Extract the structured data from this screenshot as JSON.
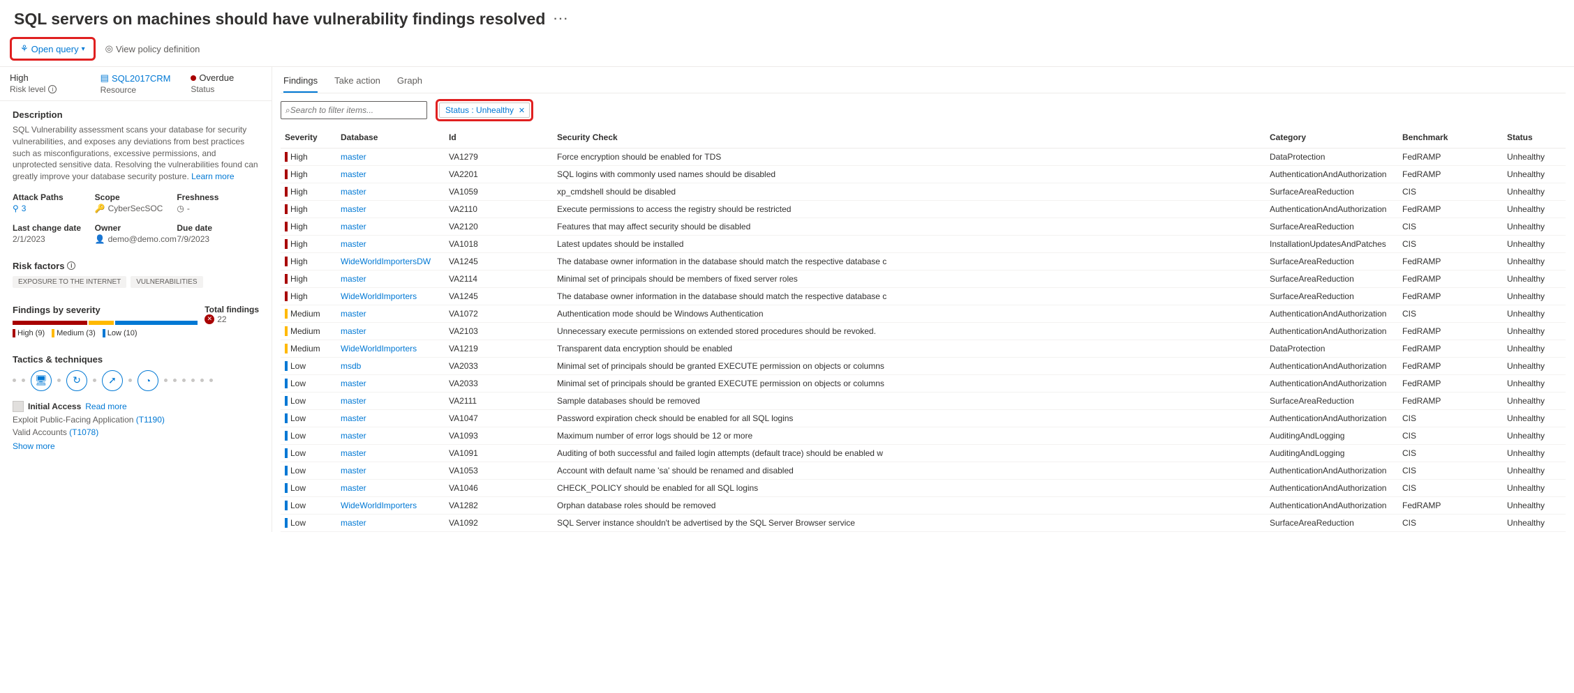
{
  "title": "SQL servers on machines should have vulnerability findings resolved",
  "toolbar": {
    "open_query": "Open query",
    "view_policy": "View policy definition"
  },
  "summary": {
    "risk_value": "High",
    "risk_label": "Risk level",
    "resource_value": "SQL2017CRM",
    "resource_label": "Resource",
    "status_value": "Overdue",
    "status_label": "Status"
  },
  "description": {
    "heading": "Description",
    "text": "SQL Vulnerability assessment scans your database for security vulnerabilities, and exposes any deviations from best practices such as misconfigurations, excessive permissions, and unprotected sensitive data. Resolving the vulnerabilities found can greatly improve your database security posture. ",
    "learn_more": "Learn more"
  },
  "meta1": {
    "attack_paths_lbl": "Attack Paths",
    "attack_paths_val": "3",
    "scope_lbl": "Scope",
    "scope_val": "CyberSecSOC",
    "freshness_lbl": "Freshness",
    "freshness_val": "-"
  },
  "meta2": {
    "last_change_lbl": "Last change date",
    "last_change_val": "2/1/2023",
    "owner_lbl": "Owner",
    "owner_val": "demo@demo.com",
    "due_lbl": "Due date",
    "due_val": "7/9/2023"
  },
  "risk_factors": {
    "heading": "Risk factors",
    "tags": [
      "EXPOSURE TO THE INTERNET",
      "VULNERABILITIES"
    ]
  },
  "findings_sev": {
    "heading": "Findings by severity",
    "high": "High (9)",
    "medium": "Medium (3)",
    "low": "Low (10)",
    "total_lbl": "Total findings",
    "total_val": "22"
  },
  "tactics": {
    "heading": "Tactics & techniques",
    "initial_access": "Initial Access",
    "read_more": "Read more",
    "line1a": "Exploit Public-Facing Application ",
    "line1b": "(T1190)",
    "line2a": "Valid Accounts ",
    "line2b": "(T1078)",
    "show_more": "Show more"
  },
  "tabs": {
    "findings": "Findings",
    "take_action": "Take action",
    "graph": "Graph"
  },
  "search": {
    "placeholder": "Search to filter items..."
  },
  "filter": {
    "label": "Status : Unhealthy"
  },
  "columns": {
    "severity": "Severity",
    "database": "Database",
    "id": "Id",
    "security_check": "Security Check",
    "category": "Category",
    "benchmark": "Benchmark",
    "status": "Status"
  },
  "rows": [
    {
      "sev": "High",
      "db": "master",
      "id": "VA1279",
      "check": "Force encryption should be enabled for TDS",
      "cat": "DataProtection",
      "bench": "FedRAMP",
      "status": "Unhealthy"
    },
    {
      "sev": "High",
      "db": "master",
      "id": "VA2201",
      "check": "SQL logins with commonly used names should be disabled",
      "cat": "AuthenticationAndAuthorization",
      "bench": "FedRAMP",
      "status": "Unhealthy"
    },
    {
      "sev": "High",
      "db": "master",
      "id": "VA1059",
      "check": "xp_cmdshell should be disabled",
      "cat": "SurfaceAreaReduction",
      "bench": "CIS",
      "status": "Unhealthy"
    },
    {
      "sev": "High",
      "db": "master",
      "id": "VA2110",
      "check": "Execute permissions to access the registry should be restricted",
      "cat": "AuthenticationAndAuthorization",
      "bench": "FedRAMP",
      "status": "Unhealthy"
    },
    {
      "sev": "High",
      "db": "master",
      "id": "VA2120",
      "check": "Features that may affect security should be disabled",
      "cat": "SurfaceAreaReduction",
      "bench": "CIS",
      "status": "Unhealthy"
    },
    {
      "sev": "High",
      "db": "master",
      "id": "VA1018",
      "check": "Latest updates should be installed",
      "cat": "InstallationUpdatesAndPatches",
      "bench": "CIS",
      "status": "Unhealthy"
    },
    {
      "sev": "High",
      "db": "WideWorldImportersDW",
      "id": "VA1245",
      "check": "The database owner information in the database should match the respective database c",
      "cat": "SurfaceAreaReduction",
      "bench": "FedRAMP",
      "status": "Unhealthy"
    },
    {
      "sev": "High",
      "db": "master",
      "id": "VA2114",
      "check": "Minimal set of principals should be members of fixed server roles",
      "cat": "SurfaceAreaReduction",
      "bench": "FedRAMP",
      "status": "Unhealthy"
    },
    {
      "sev": "High",
      "db": "WideWorldImporters",
      "id": "VA1245",
      "check": "The database owner information in the database should match the respective database c",
      "cat": "SurfaceAreaReduction",
      "bench": "FedRAMP",
      "status": "Unhealthy"
    },
    {
      "sev": "Medium",
      "db": "master",
      "id": "VA1072",
      "check": "Authentication mode should be Windows Authentication",
      "cat": "AuthenticationAndAuthorization",
      "bench": "CIS",
      "status": "Unhealthy"
    },
    {
      "sev": "Medium",
      "db": "master",
      "id": "VA2103",
      "check": "Unnecessary execute permissions on extended stored procedures should be revoked.",
      "cat": "AuthenticationAndAuthorization",
      "bench": "FedRAMP",
      "status": "Unhealthy"
    },
    {
      "sev": "Medium",
      "db": "WideWorldImporters",
      "id": "VA1219",
      "check": "Transparent data encryption should be enabled",
      "cat": "DataProtection",
      "bench": "FedRAMP",
      "status": "Unhealthy"
    },
    {
      "sev": "Low",
      "db": "msdb",
      "id": "VA2033",
      "check": "Minimal set of principals should be granted EXECUTE permission on objects or columns",
      "cat": "AuthenticationAndAuthorization",
      "bench": "FedRAMP",
      "status": "Unhealthy"
    },
    {
      "sev": "Low",
      "db": "master",
      "id": "VA2033",
      "check": "Minimal set of principals should be granted EXECUTE permission on objects or columns",
      "cat": "AuthenticationAndAuthorization",
      "bench": "FedRAMP",
      "status": "Unhealthy"
    },
    {
      "sev": "Low",
      "db": "master",
      "id": "VA2111",
      "check": "Sample databases should be removed",
      "cat": "SurfaceAreaReduction",
      "bench": "FedRAMP",
      "status": "Unhealthy"
    },
    {
      "sev": "Low",
      "db": "master",
      "id": "VA1047",
      "check": "Password expiration check should be enabled for all SQL logins",
      "cat": "AuthenticationAndAuthorization",
      "bench": "CIS",
      "status": "Unhealthy"
    },
    {
      "sev": "Low",
      "db": "master",
      "id": "VA1093",
      "check": "Maximum number of error logs should be 12 or more",
      "cat": "AuditingAndLogging",
      "bench": "CIS",
      "status": "Unhealthy"
    },
    {
      "sev": "Low",
      "db": "master",
      "id": "VA1091",
      "check": "Auditing of both successful and failed login attempts (default trace) should be enabled w",
      "cat": "AuditingAndLogging",
      "bench": "CIS",
      "status": "Unhealthy"
    },
    {
      "sev": "Low",
      "db": "master",
      "id": "VA1053",
      "check": "Account with default name 'sa' should be renamed and disabled",
      "cat": "AuthenticationAndAuthorization",
      "bench": "CIS",
      "status": "Unhealthy"
    },
    {
      "sev": "Low",
      "db": "master",
      "id": "VA1046",
      "check": "CHECK_POLICY should be enabled for all SQL logins",
      "cat": "AuthenticationAndAuthorization",
      "bench": "CIS",
      "status": "Unhealthy"
    },
    {
      "sev": "Low",
      "db": "WideWorldImporters",
      "id": "VA1282",
      "check": "Orphan database roles should be removed",
      "cat": "AuthenticationAndAuthorization",
      "bench": "FedRAMP",
      "status": "Unhealthy"
    },
    {
      "sev": "Low",
      "db": "master",
      "id": "VA1092",
      "check": "SQL Server instance shouldn't be advertised by the SQL Server Browser service",
      "cat": "SurfaceAreaReduction",
      "bench": "CIS",
      "status": "Unhealthy"
    }
  ]
}
